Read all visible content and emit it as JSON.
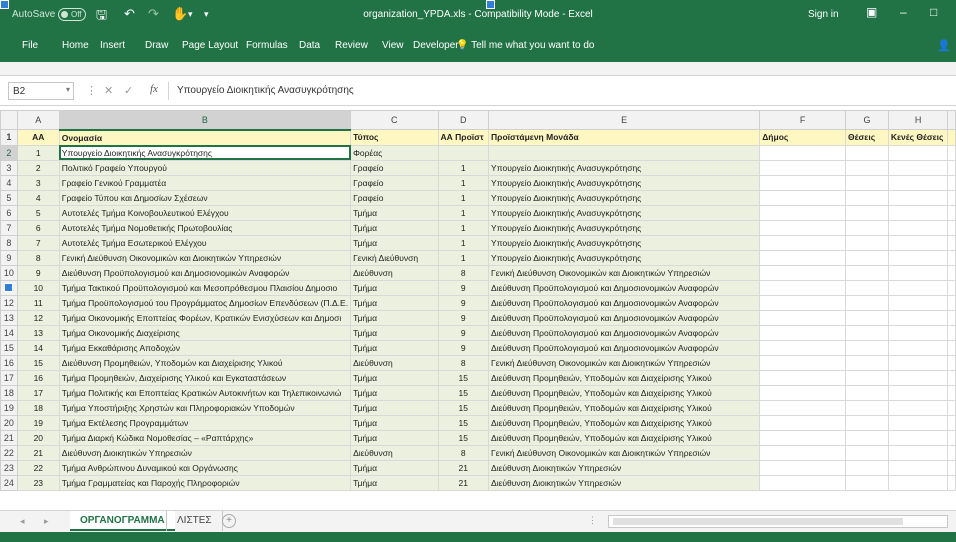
{
  "titlebar": {
    "autosave": "AutoSave",
    "autosave_state": "Off",
    "title": "organization_YPDA.xls  -  Compatibility Mode  -  Excel",
    "signin": "Sign in"
  },
  "ribbon": {
    "tabs": [
      "File",
      "Home",
      "Insert",
      "Draw",
      "Page Layout",
      "Formulas",
      "Data",
      "Review",
      "View",
      "Developer"
    ],
    "tell": "Tell me what you want to do"
  },
  "formula_bar": {
    "namebox": "B2",
    "fx": "fx",
    "content": "Υπουργείο Διοικητικής Ανασυγκρότησης"
  },
  "columns": [
    "A",
    "B",
    "C",
    "D",
    "E",
    "F",
    "G",
    "H"
  ],
  "header_row": {
    "a": "ΑΑ",
    "b": "Ονομασία",
    "c": "Τύπος",
    "d": "ΑΑ Προϊστ",
    "e": "Προϊστάμενη Μονάδα",
    "f": "Δήμος",
    "g": "Θέσεις",
    "h": "Κενές Θέσεις"
  },
  "rows": [
    {
      "rn": "2",
      "a": "1",
      "b": "Υπουργείο Διοικητικής Ανασυγκρότησης",
      "c": "Φορέας",
      "d": "",
      "e": ""
    },
    {
      "rn": "3",
      "a": "2",
      "b": "Πολιτικό Γραφείο Υπουργού",
      "c": "Γραφείο",
      "d": "1",
      "e": "Υπουργείο Διοικητικής Ανασυγκρότησης"
    },
    {
      "rn": "4",
      "a": "3",
      "b": "Γραφείο Γενικού Γραμματέα",
      "c": "Γραφείο",
      "d": "1",
      "e": "Υπουργείο Διοικητικής Ανασυγκρότησης"
    },
    {
      "rn": "5",
      "a": "4",
      "b": "Γραφείο Τύπου και Δημοσίων Σχέσεων",
      "c": "Γραφείο",
      "d": "1",
      "e": "Υπουργείο Διοικητικής Ανασυγκρότησης"
    },
    {
      "rn": "6",
      "a": "5",
      "b": "Αυτοτελές Τμήμα Κοινοβουλευτικού Ελέγχου",
      "c": "Τμήμα",
      "d": "1",
      "e": "Υπουργείο Διοικητικής Ανασυγκρότησης"
    },
    {
      "rn": "7",
      "a": "6",
      "b": "Αυτοτελές Τμήμα Νομοθετικής Πρωτοβουλίας",
      "c": "Τμήμα",
      "d": "1",
      "e": "Υπουργείο Διοικητικής Ανασυγκρότησης"
    },
    {
      "rn": "8",
      "a": "7",
      "b": "Αυτοτελές Τμήμα Εσωτερικού Ελέγχου",
      "c": "Τμήμα",
      "d": "1",
      "e": "Υπουργείο Διοικητικής Ανασυγκρότησης"
    },
    {
      "rn": "9",
      "a": "8",
      "b": "Γενική Διεύθυνση Οικονομικών και Διοικητικών Υπηρεσιών",
      "c": "Γενική Διεύθυνση",
      "d": "1",
      "e": "Υπουργείο Διοικητικής Ανασυγκρότησης"
    },
    {
      "rn": "10",
      "a": "9",
      "b": "Διεύθυνση Προϋπολογισμού και Δημοσιονομικών Αναφορών",
      "c": "Διεύθυνση",
      "d": "8",
      "e": "Γενική Διεύθυνση Οικονομικών και Διοικητικών Υπηρεσιών"
    },
    {
      "rn": "11",
      "a": "10",
      "b": "Τμήμα Τακτικού Προϋπολογισμού και Μεσοπρόθεσμου Πλαισίου Δημοσιο",
      "c": "Τμήμα",
      "d": "9",
      "e": "Διεύθυνση Προϋπολογισμού και Δημοσιονομικών Αναφορών"
    },
    {
      "rn": "12",
      "a": "11",
      "b": "Τμήμα Προϋπολογισμού του Προγράμματος Δημοσίων Επενδύσεων (Π.Δ.Ε.",
      "c": "Τμήμα",
      "d": "9",
      "e": "Διεύθυνση Προϋπολογισμού και Δημοσιονομικών Αναφορών"
    },
    {
      "rn": "13",
      "a": "12",
      "b": "Τμήμα Οικονομικής Εποπτείας Φορέων, Κρατικών Ενισχύσεων και Δημοσι",
      "c": "Τμήμα",
      "d": "9",
      "e": "Διεύθυνση Προϋπολογισμού και Δημοσιονομικών Αναφορών"
    },
    {
      "rn": "14",
      "a": "13",
      "b": "Τμήμα Οικονομικής Διαχείρισης",
      "c": "Τμήμα",
      "d": "9",
      "e": "Διεύθυνση Προϋπολογισμού και Δημοσιονομικών Αναφορών"
    },
    {
      "rn": "15",
      "a": "14",
      "b": "Τμήμα Εκκαθάρισης Αποδοχών",
      "c": "Τμήμα",
      "d": "9",
      "e": "Διεύθυνση Προϋπολογισμού και Δημοσιονομικών Αναφορών"
    },
    {
      "rn": "16",
      "a": "15",
      "b": "Διεύθυνση Προμηθειών, Υποδομών και Διαχείρισης Υλικού",
      "c": "Διεύθυνση",
      "d": "8",
      "e": "Γενική Διεύθυνση Οικονομικών και Διοικητικών Υπηρεσιών"
    },
    {
      "rn": "17",
      "a": "16",
      "b": "Τμήμα Προμηθειών, Διαχείρισης Υλικού και Εγκαταστάσεων",
      "c": "Τμήμα",
      "d": "15",
      "e": "Διεύθυνση Προμηθειών, Υποδομών και Διαχείρισης Υλικού"
    },
    {
      "rn": "18",
      "a": "17",
      "b": "Τμήμα Πολιτικής και Εποπτείας Κρατικών Αυτοκινήτων και Τηλεπικοινωνιώ",
      "c": "Τμήμα",
      "d": "15",
      "e": "Διεύθυνση Προμηθειών, Υποδομών και Διαχείρισης Υλικού"
    },
    {
      "rn": "19",
      "a": "18",
      "b": "Τμήμα Υποστήριξης Χρηστών και Πληροφοριακών Υποδομών",
      "c": "Τμήμα",
      "d": "15",
      "e": "Διεύθυνση Προμηθειών, Υποδομών και Διαχείρισης Υλικού"
    },
    {
      "rn": "20",
      "a": "19",
      "b": "Τμήμα Εκτέλεσης Προγραμμάτων",
      "c": "Τμήμα",
      "d": "15",
      "e": "Διεύθυνση Προμηθειών, Υποδομών και Διαχείρισης Υλικού"
    },
    {
      "rn": "21",
      "a": "20",
      "b": "Τμήμα Διαρκή Κώδικα Νομοθεσίας – «Ραπτάρχης»",
      "c": "Τμήμα",
      "d": "15",
      "e": "Διεύθυνση Προμηθειών, Υποδομών και Διαχείρισης Υλικού"
    },
    {
      "rn": "22",
      "a": "21",
      "b": "Διεύθυνση Διοικητικών Υπηρεσιών",
      "c": "Διεύθυνση",
      "d": "8",
      "e": "Γενική Διεύθυνση Οικονομικών και Διοικητικών Υπηρεσιών"
    },
    {
      "rn": "23",
      "a": "22",
      "b": "Τμήμα Ανθρώπινου Δυναμικού και Οργάνωσης",
      "c": "Τμήμα",
      "d": "21",
      "e": "Διεύθυνση Διοικητικών Υπηρεσιών"
    },
    {
      "rn": "24",
      "a": "23",
      "b": "Τμήμα Γραμματείας και Παροχής Πληροφοριών",
      "c": "Τμήμα",
      "d": "21",
      "e": "Διεύθυνση Διοικητικών Υπηρεσιών"
    }
  ],
  "sheet_tabs": {
    "active": "ΟΡΓΑΝΟΓΡΑΜΜΑ",
    "other": "ΛΙΣΤΕΣ"
  },
  "colors": {
    "excel_green": "#217346",
    "header_fill": "#fff7c2",
    "green_fill": "#ebf1de"
  }
}
